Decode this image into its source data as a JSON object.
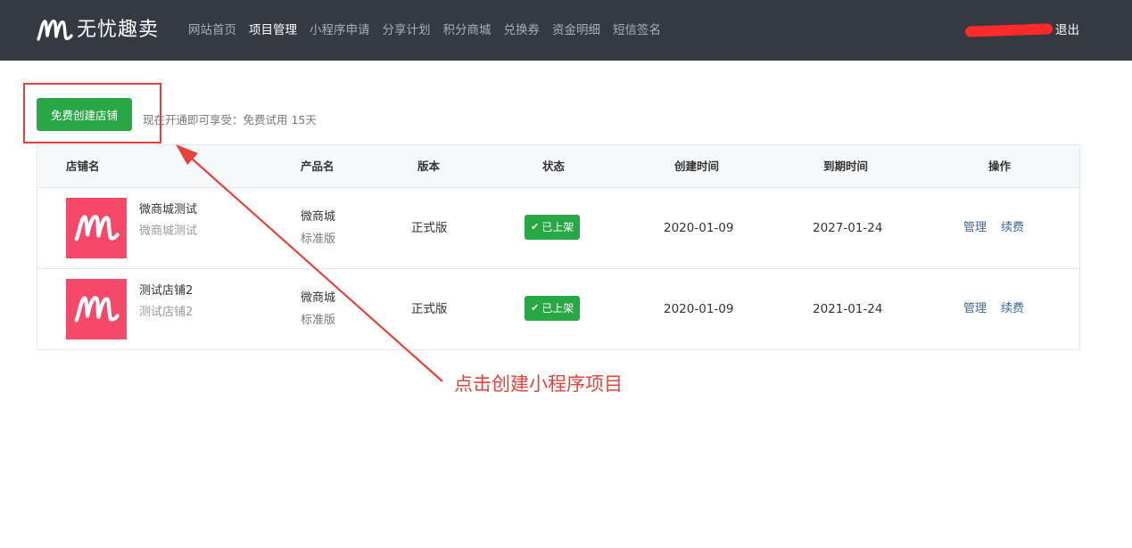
{
  "brand": {
    "name": "无忧趣卖",
    "logo_icon": "wm-logo-icon"
  },
  "nav": {
    "items": [
      {
        "label": "网站首页",
        "active": false
      },
      {
        "label": "项目管理",
        "active": true
      },
      {
        "label": "小程序申请",
        "active": false
      },
      {
        "label": "分享计划",
        "active": false
      },
      {
        "label": "积分商城",
        "active": false
      },
      {
        "label": "兑换券",
        "active": false
      },
      {
        "label": "资金明细",
        "active": false
      },
      {
        "label": "短信签名",
        "active": false
      }
    ],
    "logout_label": "退出"
  },
  "toolbar": {
    "create_label": "免费创建店铺",
    "promo_text": "现在开通即可享受：免费试用 15天"
  },
  "table": {
    "headers": {
      "store": "店铺名",
      "product": "产品名",
      "version": "版本",
      "status": "状态",
      "created": "创建时间",
      "expires": "到期时间",
      "actions": "操作"
    },
    "rows": [
      {
        "name": "微商城测试",
        "subtitle": "微商城测试",
        "product": "微商城",
        "product_edition": "标准版",
        "version": "正式版",
        "status": "已上架",
        "created": "2020-01-09",
        "expires": "2027-01-24",
        "manage": "管理",
        "renew": "续费"
      },
      {
        "name": "测试店铺2",
        "subtitle": "测试店铺2",
        "product": "微商城",
        "product_edition": "标准版",
        "version": "正式版",
        "status": "已上架",
        "created": "2020-01-09",
        "expires": "2021-01-24",
        "manage": "管理",
        "renew": "续费"
      }
    ]
  },
  "annotation": {
    "text": "点击创建小程序项目",
    "color": "#e8413a"
  },
  "colors": {
    "navbar": "#353a42",
    "primary_green": "#28a745",
    "thumb_pink": "#f64868",
    "link": "#3d6a9e"
  }
}
